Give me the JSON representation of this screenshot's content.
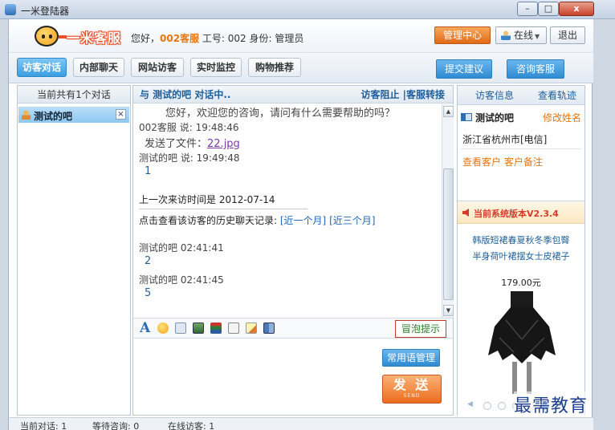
{
  "window": {
    "title": "一米登陆器",
    "min_label": "–",
    "max_label": "□",
    "close_label": "x"
  },
  "header": {
    "logo_text": "一米客服",
    "greeting_prefix": "您好，",
    "agent_name": "002客服",
    "greeting_suffix": " 工号: 002 身份: 管理员",
    "admin_button": "管理中心",
    "status_button": "在线",
    "exit_button": "退出"
  },
  "tabs": [
    {
      "label": "访客对话",
      "active": true
    },
    {
      "label": "内部聊天",
      "active": false
    },
    {
      "label": "网站访客",
      "active": false
    },
    {
      "label": "实时监控",
      "active": false
    },
    {
      "label": "购物推荐",
      "active": false
    }
  ],
  "actions": {
    "suggest": "提交建议",
    "consult": "咨询客服"
  },
  "left_panel": {
    "header": "当前共有1个对话",
    "visitors": [
      {
        "name": "测试的吧",
        "close": "×"
      }
    ]
  },
  "chat_panel": {
    "header": "与 测试的吧 对话中..",
    "header_links": "访客阻止 |客服转接",
    "messages": {
      "welcome": "您好，欢迎您的咨询，请问有什么需要帮助的吗？",
      "agent_meta": "002客服 说: 19:48:46",
      "file_sent_prefix": "发送了文件：",
      "file_name": "22.jpg",
      "visitor_meta_1": "测试的吧 说: 19:49:48",
      "visitor_msg_1": "1",
      "last_visit": "上一次来访时间是 2012-07-14",
      "history_prefix": "点击查看该访客的历史聊天记录: ",
      "history_link_1": "[近一个月]",
      "history_link_2": "[近三个月]",
      "visitor_meta_2": "测试的吧 02:41:41",
      "visitor_msg_2": "2",
      "visitor_meta_3": "测试的吧 02:41:45",
      "visitor_msg_3": "5"
    },
    "toolbar": {
      "font_glyph": "A",
      "bubble_button": "冒泡提示"
    },
    "phrases_button": "常用语管理",
    "send_button": "发 送",
    "send_sub": "SEND"
  },
  "right_panel": {
    "tab_info": "访客信息",
    "tab_track": "查看轨迹",
    "visitor_name": "测试的吧",
    "edit_name": "修改姓名",
    "location": "浙江省杭州市[电信]",
    "actions": "查看客户  客户备注",
    "promo": {
      "version": "当前系统版本V2.3.4",
      "product_line_1": "韩版短裙春夏秋冬季包臀",
      "product_line_2": "半身荷叶裙摆女士皮裙子",
      "price": "179.00元",
      "slides_total": 5,
      "slide_active": 5
    }
  },
  "status_bar": {
    "current": "当前对话: 1",
    "waiting": "等待咨询: 0",
    "online": "在线访客: 1"
  },
  "watermark": "最需教育"
}
